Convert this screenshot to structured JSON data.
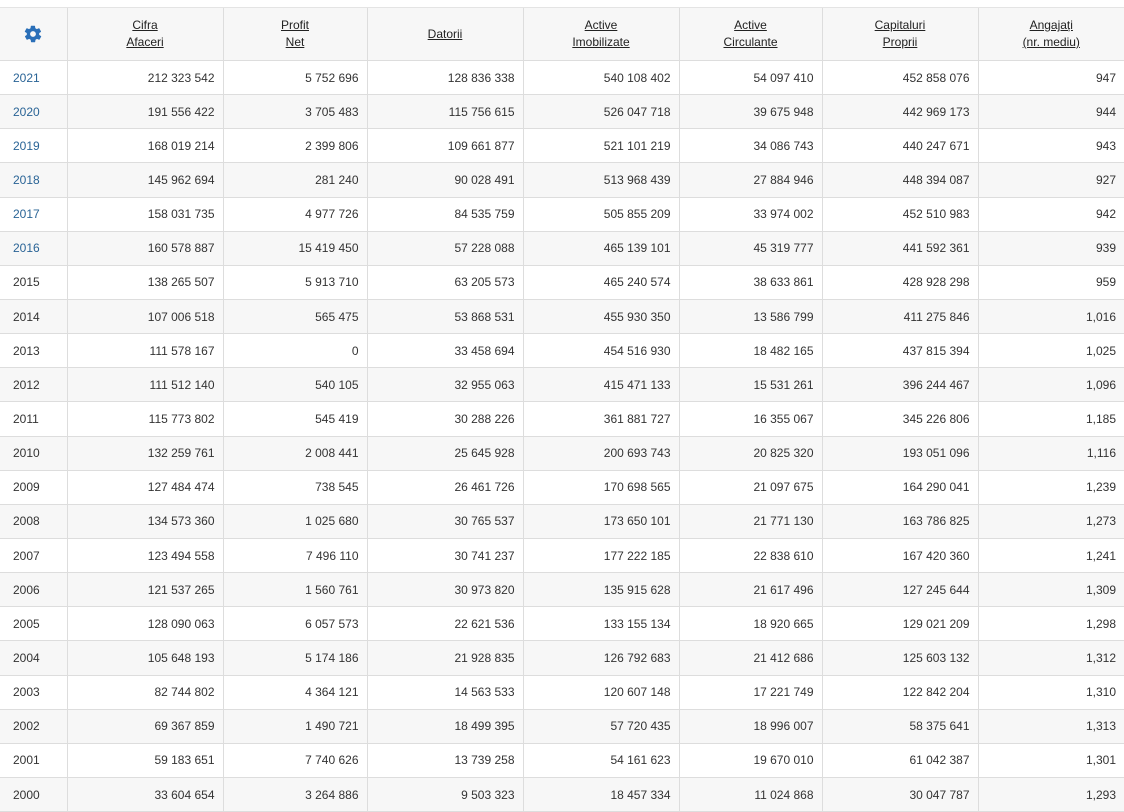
{
  "colors": {
    "accent": "#2a6fb8",
    "link": "#2a6496",
    "header_bg": "#f7f7f7",
    "stripe_bg": "#f7f7f7"
  },
  "settings_icon": "gear-icon",
  "columns": [
    {
      "line1": "Cifra",
      "line2": "Afaceri"
    },
    {
      "line1": "Profit",
      "line2": "Net"
    },
    {
      "line1": "Datorii",
      "line2": ""
    },
    {
      "line1": "Active",
      "line2": "Imobilizate"
    },
    {
      "line1": "Active",
      "line2": "Circulante"
    },
    {
      "line1": "Capitaluri",
      "line2": "Proprii"
    },
    {
      "line1": "Angajați",
      "line2": "(nr. mediu)"
    }
  ],
  "rows": [
    {
      "year": "2021",
      "link": true,
      "cells": [
        "212 323 542",
        "5 752 696",
        "128 836 338",
        "540 108 402",
        "54 097 410",
        "452 858 076",
        "947"
      ]
    },
    {
      "year": "2020",
      "link": true,
      "cells": [
        "191 556 422",
        "3 705 483",
        "115 756 615",
        "526 047 718",
        "39 675 948",
        "442 969 173",
        "944"
      ]
    },
    {
      "year": "2019",
      "link": true,
      "cells": [
        "168 019 214",
        "2 399 806",
        "109 661 877",
        "521 101 219",
        "34 086 743",
        "440 247 671",
        "943"
      ]
    },
    {
      "year": "2018",
      "link": true,
      "cells": [
        "145 962 694",
        "281 240",
        "90 028 491",
        "513 968 439",
        "27 884 946",
        "448 394 087",
        "927"
      ]
    },
    {
      "year": "2017",
      "link": true,
      "cells": [
        "158 031 735",
        "4 977 726",
        "84 535 759",
        "505 855 209",
        "33 974 002",
        "452 510 983",
        "942"
      ]
    },
    {
      "year": "2016",
      "link": true,
      "cells": [
        "160 578 887",
        "15 419 450",
        "57 228 088",
        "465 139 101",
        "45 319 777",
        "441 592 361",
        "939"
      ]
    },
    {
      "year": "2015",
      "link": false,
      "cells": [
        "138 265 507",
        "5 913 710",
        "63 205 573",
        "465 240 574",
        "38 633 861",
        "428 928 298",
        "959"
      ]
    },
    {
      "year": "2014",
      "link": false,
      "cells": [
        "107 006 518",
        "565 475",
        "53 868 531",
        "455 930 350",
        "13 586 799",
        "411 275 846",
        "1,016"
      ]
    },
    {
      "year": "2013",
      "link": false,
      "cells": [
        "111 578 167",
        "0",
        "33 458 694",
        "454 516 930",
        "18 482 165",
        "437 815 394",
        "1,025"
      ]
    },
    {
      "year": "2012",
      "link": false,
      "cells": [
        "111 512 140",
        "540 105",
        "32 955 063",
        "415 471 133",
        "15 531 261",
        "396 244 467",
        "1,096"
      ]
    },
    {
      "year": "2011",
      "link": false,
      "cells": [
        "115 773 802",
        "545 419",
        "30 288 226",
        "361 881 727",
        "16 355 067",
        "345 226 806",
        "1,185"
      ]
    },
    {
      "year": "2010",
      "link": false,
      "cells": [
        "132 259 761",
        "2 008 441",
        "25 645 928",
        "200 693 743",
        "20 825 320",
        "193 051 096",
        "1,116"
      ]
    },
    {
      "year": "2009",
      "link": false,
      "cells": [
        "127 484 474",
        "738 545",
        "26 461 726",
        "170 698 565",
        "21 097 675",
        "164 290 041",
        "1,239"
      ]
    },
    {
      "year": "2008",
      "link": false,
      "cells": [
        "134 573 360",
        "1 025 680",
        "30 765 537",
        "173 650 101",
        "21 771 130",
        "163 786 825",
        "1,273"
      ]
    },
    {
      "year": "2007",
      "link": false,
      "cells": [
        "123 494 558",
        "7 496 110",
        "30 741 237",
        "177 222 185",
        "22 838 610",
        "167 420 360",
        "1,241"
      ]
    },
    {
      "year": "2006",
      "link": false,
      "cells": [
        "121 537 265",
        "1 560 761",
        "30 973 820",
        "135 915 628",
        "21 617 496",
        "127 245 644",
        "1,309"
      ]
    },
    {
      "year": "2005",
      "link": false,
      "cells": [
        "128 090 063",
        "6 057 573",
        "22 621 536",
        "133 155 134",
        "18 920 665",
        "129 021 209",
        "1,298"
      ]
    },
    {
      "year": "2004",
      "link": false,
      "cells": [
        "105 648 193",
        "5 174 186",
        "21 928 835",
        "126 792 683",
        "21 412 686",
        "125 603 132",
        "1,312"
      ]
    },
    {
      "year": "2003",
      "link": false,
      "cells": [
        "82 744 802",
        "4 364 121",
        "14 563 533",
        "120 607 148",
        "17 221 749",
        "122 842 204",
        "1,310"
      ]
    },
    {
      "year": "2002",
      "link": false,
      "cells": [
        "69 367 859",
        "1 490 721",
        "18 499 395",
        "57 720 435",
        "18 996 007",
        "58 375 641",
        "1,313"
      ]
    },
    {
      "year": "2001",
      "link": false,
      "cells": [
        "59 183 651",
        "7 740 626",
        "13 739 258",
        "54 161 623",
        "19 670 010",
        "61 042 387",
        "1,301"
      ]
    },
    {
      "year": "2000",
      "link": false,
      "cells": [
        "33 604 654",
        "3 264 886",
        "9 503 323",
        "18 457 334",
        "11 024 868",
        "30 047 787",
        "1,293"
      ]
    }
  ]
}
